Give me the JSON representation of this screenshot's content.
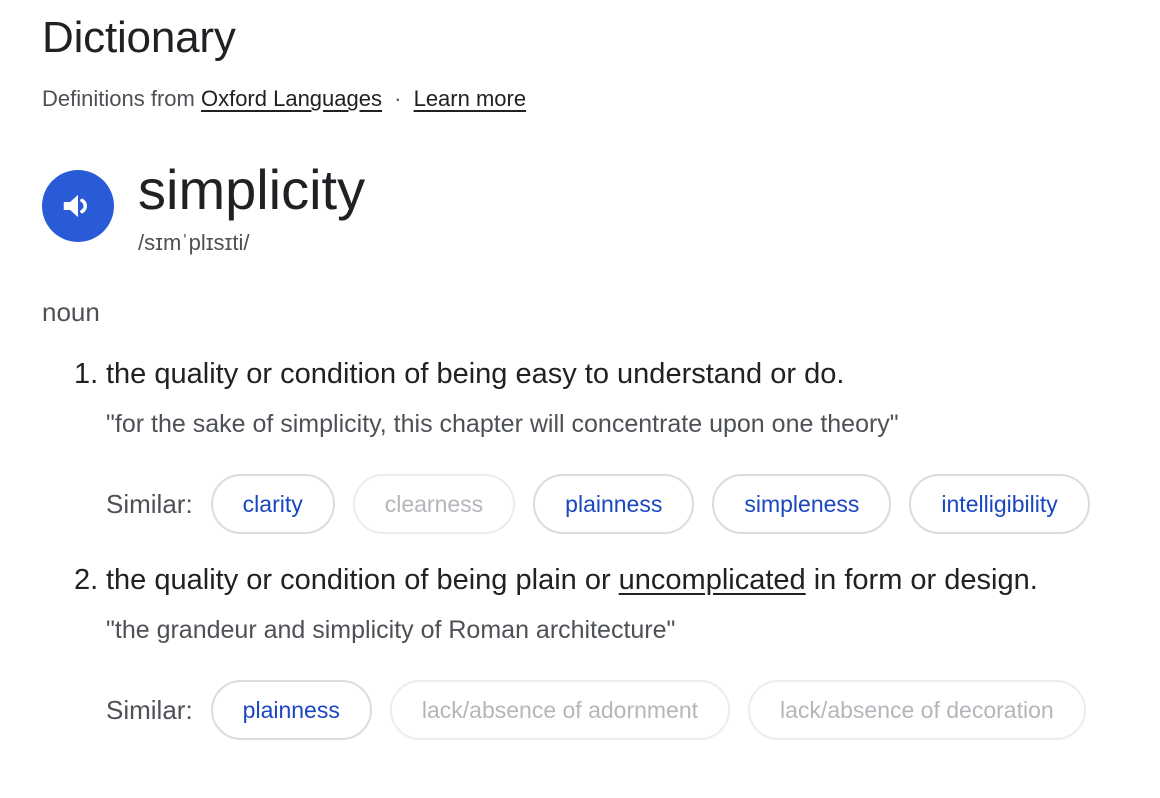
{
  "header": {
    "title": "Dictionary",
    "source_prefix": "Definitions from",
    "source_link": "Oxford Languages",
    "separator": "·",
    "learn_more": "Learn more"
  },
  "entry": {
    "word": "simplicity",
    "phonetic": "/sɪmˈplɪsɪti/",
    "speaker_icon": "volume-up-icon",
    "part_of_speech": "noun"
  },
  "senses": [
    {
      "number": "1.",
      "definition": "the quality or condition of being easy to understand or do.",
      "example": "\"for the sake of simplicity, this chapter will concentrate upon one theory\"",
      "similar_label": "Similar:",
      "similar": [
        {
          "label": "clarity",
          "muted": false
        },
        {
          "label": "clearness",
          "muted": true
        },
        {
          "label": "plainness",
          "muted": false
        },
        {
          "label": "simpleness",
          "muted": false
        },
        {
          "label": "intelligibility",
          "muted": false
        }
      ]
    },
    {
      "number": "2.",
      "definition_pre": "the quality or condition of being plain or ",
      "definition_link": "uncomplicated",
      "definition_post": " in form or design.",
      "example": "\"the grandeur and simplicity of Roman architecture\"",
      "similar_label": "Similar:",
      "similar": [
        {
          "label": "plainness",
          "muted": false
        },
        {
          "label": "lack/absence of adornment",
          "muted": true
        },
        {
          "label": "lack/absence of decoration",
          "muted": true
        }
      ]
    }
  ],
  "colors": {
    "accent_blue": "#2a5bd7",
    "link_blue": "#1a47c0",
    "muted_text": "#b3b6ba",
    "secondary_text": "#4d5156"
  }
}
